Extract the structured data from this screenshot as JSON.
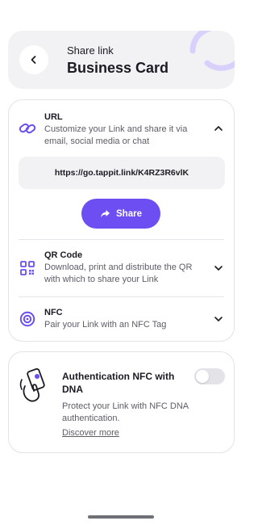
{
  "header": {
    "subtitle": "Share link",
    "title": "Business Card"
  },
  "url_section": {
    "title": "URL",
    "description": "Customize your Link and share it via email, social media or chat",
    "link": "https://go.tappit.link/K4RZ3R6vlK",
    "share_label": "Share",
    "icon": "link-icon",
    "expanded": true
  },
  "qr_section": {
    "title": "QR Code",
    "description": "Download, print and distribute the QR with which to share your Link",
    "icon": "qr-code-icon",
    "expanded": false
  },
  "nfc_section": {
    "title": "NFC",
    "description": "Pair your Link with an NFC Tag",
    "icon": "nfc-target-icon",
    "expanded": false
  },
  "auth": {
    "title": "Authentication NFC with DNA",
    "description": "Protect your Link with NFC DNA authentication.",
    "link": "Discover more",
    "toggle_on": false,
    "icon": "phone-tap-icon"
  },
  "colors": {
    "accent": "#6c4ef2",
    "header_bg": "#f2f2f5",
    "text": "#1b1b23",
    "muted": "#5c5c66"
  }
}
